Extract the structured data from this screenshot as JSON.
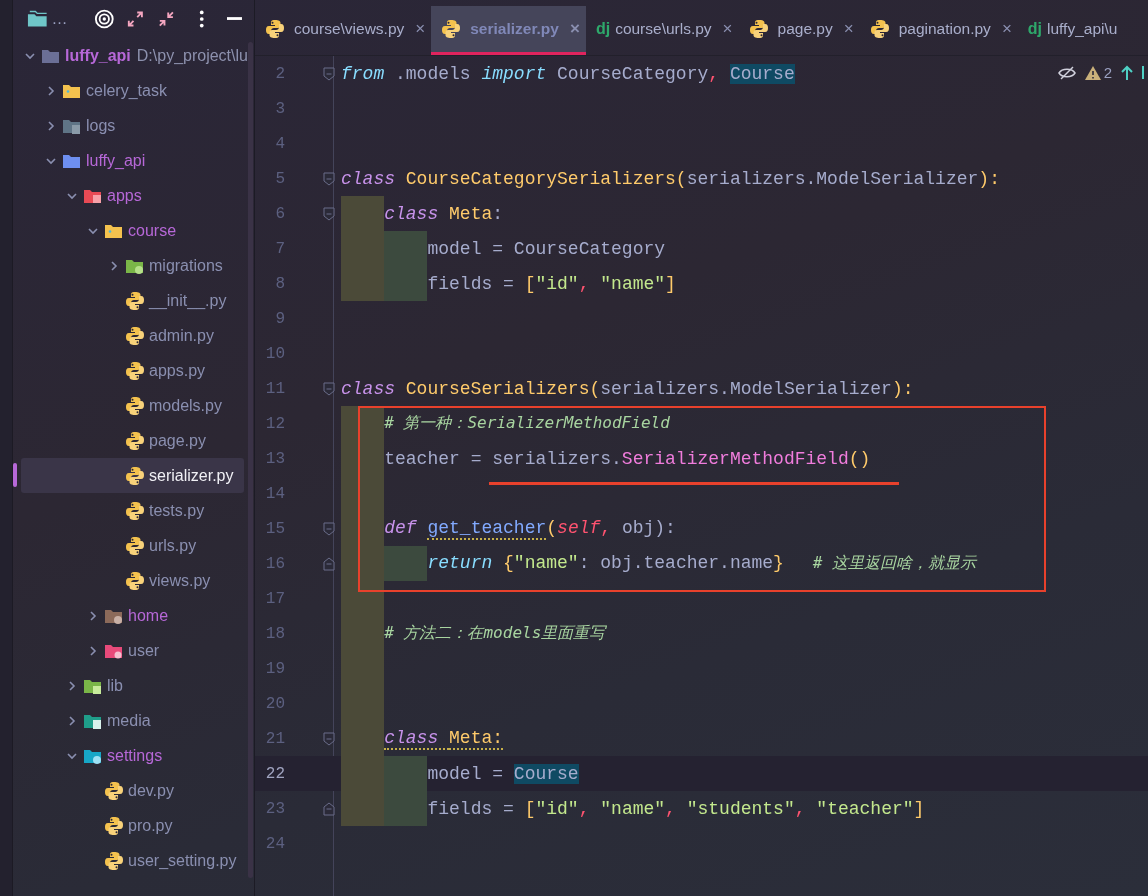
{
  "sidebar": {
    "title": "…",
    "tree": [
      {
        "label": "luffy_api",
        "path": "D:\\py_project\\lu",
        "kind": "root",
        "color": "#b768d8",
        "bold": true,
        "selected": false,
        "expanded": true,
        "children": [
          {
            "label": "celery_task",
            "kind": "folder",
            "color": "#8a8fb0",
            "bold": false,
            "selected": false,
            "expanded": false
          },
          {
            "label": "logs",
            "kind": "folder-doc",
            "color": "#8a8fb0",
            "bold": false,
            "selected": false,
            "expanded": false
          },
          {
            "label": "luffy_api",
            "kind": "folder-blue",
            "color": "#b768d8",
            "bold": false,
            "selected": false,
            "expanded": true,
            "children": [
              {
                "label": "apps",
                "kind": "folder-grid",
                "color": "#b768d8",
                "bold": false,
                "selected": false,
                "expanded": true,
                "children": [
                  {
                    "label": "course",
                    "kind": "folder",
                    "color": "#b768d8",
                    "bold": false,
                    "selected": false,
                    "expanded": true,
                    "children": [
                      {
                        "label": "migrations",
                        "kind": "folder-db",
                        "color": "#8a8fb0",
                        "bold": false,
                        "selected": false,
                        "expanded": false
                      },
                      {
                        "label": "__init__.py",
                        "kind": "python",
                        "color": "#8a8fb0",
                        "bold": false,
                        "selected": false
                      },
                      {
                        "label": "admin.py",
                        "kind": "python",
                        "color": "#8a8fb0",
                        "bold": false,
                        "selected": false
                      },
                      {
                        "label": "apps.py",
                        "kind": "python",
                        "color": "#8a8fb0",
                        "bold": false,
                        "selected": false
                      },
                      {
                        "label": "models.py",
                        "kind": "python",
                        "color": "#8a8fb0",
                        "bold": false,
                        "selected": false
                      },
                      {
                        "label": "page.py",
                        "kind": "python",
                        "color": "#8a8fb0",
                        "bold": false,
                        "selected": false
                      },
                      {
                        "label": "serializer.py",
                        "kind": "python",
                        "color": "#f0f0f5",
                        "bold": false,
                        "selected": true
                      },
                      {
                        "label": "tests.py",
                        "kind": "python",
                        "color": "#8a8fb0",
                        "bold": false,
                        "selected": false
                      },
                      {
                        "label": "urls.py",
                        "kind": "python",
                        "color": "#8a8fb0",
                        "bold": false,
                        "selected": false
                      },
                      {
                        "label": "views.py",
                        "kind": "python",
                        "color": "#8a8fb0",
                        "bold": false,
                        "selected": false
                      }
                    ]
                  },
                  {
                    "label": "home",
                    "kind": "folder-home",
                    "color": "#b768d8",
                    "bold": false,
                    "selected": false,
                    "expanded": false
                  },
                  {
                    "label": "user",
                    "kind": "folder-user",
                    "color": "#8a8fb0",
                    "bold": false,
                    "selected": false,
                    "expanded": false
                  }
                ]
              },
              {
                "label": "lib",
                "kind": "folder-lib",
                "color": "#8a8fb0",
                "bold": false,
                "selected": false,
                "expanded": false
              },
              {
                "label": "media",
                "kind": "folder-media",
                "color": "#8a8fb0",
                "bold": false,
                "selected": false,
                "expanded": false
              },
              {
                "label": "settings",
                "kind": "folder-gear",
                "color": "#b768d8",
                "bold": false,
                "selected": false,
                "expanded": true,
                "children": [
                  {
                    "label": "dev.py",
                    "kind": "python",
                    "color": "#8a8fb0",
                    "bold": false,
                    "selected": false
                  },
                  {
                    "label": "pro.py",
                    "kind": "python",
                    "color": "#8a8fb0",
                    "bold": false,
                    "selected": false
                  },
                  {
                    "label": "user_setting.py",
                    "kind": "python",
                    "color": "#8a8fb0",
                    "bold": false,
                    "selected": false
                  }
                ]
              }
            ]
          }
        ]
      }
    ]
  },
  "tabs": [
    {
      "label": "course\\views.py",
      "kind": "python",
      "selected": false,
      "close": "×"
    },
    {
      "label": "serializer.py",
      "kind": "python",
      "selected": true,
      "close": "×"
    },
    {
      "label": "course\\urls.py",
      "kind": "django",
      "icon_text": "dj",
      "selected": false,
      "close": "×"
    },
    {
      "label": "page.py",
      "kind": "python",
      "selected": false,
      "close": "×"
    },
    {
      "label": "pagination.py",
      "kind": "python",
      "selected": false,
      "close": "×"
    },
    {
      "label": "luffy_api\\u",
      "kind": "django",
      "icon_text": "dj",
      "selected": false
    }
  ],
  "inspections": {
    "warnings": "2"
  },
  "editor": {
    "lines": [
      {
        "number": "2",
        "current": false,
        "kind": "fold-start",
        "tokens": [
          {
            "kind": "kw2",
            "text": "from",
            "squiggle": false
          },
          {
            "kind": "plain",
            "text": " .models ",
            "squiggle": false
          },
          {
            "kind": "kw2",
            "text": "import",
            "squiggle": false
          },
          {
            "kind": "plain",
            "text": " CourseCategory",
            "squiggle": false
          },
          {
            "kind": "op",
            "text": ", ",
            "squiggle": false
          },
          {
            "kind": "hl",
            "text": "Course",
            "squiggle": false
          }
        ]
      },
      {
        "number": "3",
        "current": false,
        "kind": "plain"
      },
      {
        "number": "4",
        "current": false,
        "kind": "plain"
      },
      {
        "number": "5",
        "current": false,
        "kind": "fold-start",
        "tokens": [
          {
            "kind": "kw",
            "text": "class ",
            "squiggle": false
          },
          {
            "kind": "cls",
            "text": "CourseCategorySerializers",
            "squiggle": false
          },
          {
            "kind": "bracket",
            "text": "(",
            "squiggle": false
          },
          {
            "kind": "plain",
            "text": "serializers.ModelSerializer",
            "squiggle": false
          },
          {
            "kind": "bracket",
            "text": "):",
            "squiggle": false
          }
        ]
      },
      {
        "number": "6",
        "current": false,
        "kind": "fold-start",
        "tokens": [
          {
            "kind": "kw",
            "text": "    class ",
            "squiggle": false
          },
          {
            "kind": "cls",
            "text": "Meta",
            "squiggle": false
          },
          {
            "kind": "plain",
            "text": ":",
            "squiggle": false
          }
        ]
      },
      {
        "number": "7",
        "current": false,
        "kind": "plain",
        "tokens": [
          {
            "kind": "plain",
            "text": "        model = CourseCategory",
            "squiggle": false
          }
        ]
      },
      {
        "number": "8",
        "current": false,
        "kind": "plain",
        "tokens": [
          {
            "kind": "plain",
            "text": "        fields = ",
            "squiggle": false
          },
          {
            "kind": "bracket",
            "text": "[",
            "squiggle": false
          },
          {
            "kind": "str",
            "text": "\"id\"",
            "squiggle": false
          },
          {
            "kind": "op",
            "text": ", ",
            "squiggle": false
          },
          {
            "kind": "str",
            "text": "\"name\"",
            "squiggle": false
          },
          {
            "kind": "bracket",
            "text": "]",
            "squiggle": false
          }
        ]
      },
      {
        "number": "9",
        "current": false,
        "kind": "plain"
      },
      {
        "number": "10",
        "current": false,
        "kind": "plain"
      },
      {
        "number": "11",
        "current": false,
        "kind": "fold-start",
        "tokens": [
          {
            "kind": "kw",
            "text": "class ",
            "squiggle": false
          },
          {
            "kind": "cls",
            "text": "CourseSerializers",
            "squiggle": false
          },
          {
            "kind": "bracket",
            "text": "(",
            "squiggle": false
          },
          {
            "kind": "plain",
            "text": "serializers.ModelSerializer",
            "squiggle": false
          },
          {
            "kind": "bracket",
            "text": "):",
            "squiggle": false
          }
        ]
      },
      {
        "number": "12",
        "current": false,
        "kind": "plain",
        "tokens": [
          {
            "kind": "comment",
            "text": "    # 第一种：SerializerMethodField",
            "squiggle": false
          }
        ]
      },
      {
        "number": "13",
        "current": false,
        "kind": "plain",
        "tokens": [
          {
            "kind": "plain",
            "text": "    teacher = serializers.",
            "squiggle": false
          },
          {
            "kind": "fn",
            "text": "SerializerMethodField",
            "squiggle": false
          },
          {
            "kind": "bracket",
            "text": "()",
            "squiggle": false
          }
        ]
      },
      {
        "number": "14",
        "current": false,
        "kind": "plain"
      },
      {
        "number": "15",
        "current": false,
        "kind": "fold-start",
        "tokens": [
          {
            "kind": "kw",
            "text": "    def ",
            "squiggle": false
          },
          {
            "kind": "method",
            "text": "get_teacher",
            "squiggle": true
          },
          {
            "kind": "bracket",
            "text": "(",
            "squiggle": false
          },
          {
            "kind": "self",
            "text": "self",
            "squiggle": false
          },
          {
            "kind": "op",
            "text": ", ",
            "squiggle": false
          },
          {
            "kind": "plain",
            "text": "obj):",
            "squiggle": false
          }
        ]
      },
      {
        "number": "16",
        "current": false,
        "kind": "fold-end",
        "tokens": [
          {
            "kind": "kw2",
            "text": "        return ",
            "squiggle": false
          },
          {
            "kind": "bracket",
            "text": "{",
            "squiggle": false
          },
          {
            "kind": "str",
            "text": "\"name\"",
            "squiggle": false
          },
          {
            "kind": "plain",
            "text": ": obj.teacher.name",
            "squiggle": false
          },
          {
            "kind": "bracket",
            "text": "}",
            "squiggle": false
          },
          {
            "kind": "comment",
            "text": "   # 这里返回啥，就显示",
            "squiggle": false
          }
        ]
      },
      {
        "number": "17",
        "current": false,
        "kind": "plain"
      },
      {
        "number": "18",
        "current": false,
        "kind": "plain",
        "tokens": [
          {
            "kind": "comment",
            "text": "    # 方法二：在models里面重写",
            "squiggle": false
          }
        ]
      },
      {
        "number": "19",
        "current": false,
        "kind": "plain"
      },
      {
        "number": "20",
        "current": false,
        "kind": "plain"
      },
      {
        "number": "21",
        "current": false,
        "kind": "fold-start",
        "tokens": [
          {
            "kind": "kw",
            "text": "    class ",
            "squiggle": true
          },
          {
            "kind": "cls",
            "text": "Meta:",
            "squiggle": true
          }
        ]
      },
      {
        "number": "22",
        "current": true,
        "kind": "plain",
        "tokens": [
          {
            "kind": "plain",
            "text": "        model = ",
            "squiggle": false
          },
          {
            "kind": "hl",
            "text": "Course",
            "squiggle": false
          }
        ]
      },
      {
        "number": "23",
        "current": false,
        "kind": "fold-end",
        "tokens": [
          {
            "kind": "plain",
            "text": "        fields = ",
            "squiggle": false
          },
          {
            "kind": "bracket",
            "text": "[",
            "squiggle": false
          },
          {
            "kind": "str",
            "text": "\"id\"",
            "squiggle": false
          },
          {
            "kind": "op",
            "text": ", ",
            "squiggle": false
          },
          {
            "kind": "str",
            "text": "\"name\"",
            "squiggle": false
          },
          {
            "kind": "op",
            "text": ", ",
            "squiggle": false
          },
          {
            "kind": "str",
            "text": "\"students\"",
            "squiggle": false
          },
          {
            "kind": "op",
            "text": ", ",
            "squiggle": false
          },
          {
            "kind": "str",
            "text": "\"teacher\"",
            "squiggle": false
          },
          {
            "kind": "bracket",
            "text": "]",
            "squiggle": false
          }
        ]
      },
      {
        "number": "24",
        "current": false,
        "kind": "plain"
      }
    ]
  }
}
